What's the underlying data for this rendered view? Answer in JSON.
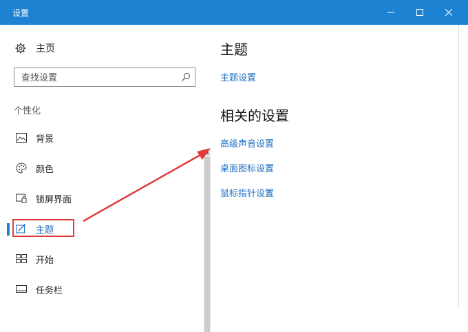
{
  "window": {
    "title": "设置",
    "accent": "#1e82d2",
    "controls": {
      "minimize": "—",
      "maximize": "☐",
      "close": "✕"
    }
  },
  "sidebar": {
    "home_label": "主页",
    "search_placeholder": "查找设置",
    "section_label": "个性化",
    "items": [
      {
        "label": "背景",
        "icon": "image-icon"
      },
      {
        "label": "颜色",
        "icon": "palette-icon"
      },
      {
        "label": "锁屏界面",
        "icon": "lock-screen-icon"
      },
      {
        "label": "主题",
        "icon": "theme-icon",
        "selected": true
      },
      {
        "label": "开始",
        "icon": "start-icon"
      },
      {
        "label": "任务栏",
        "icon": "taskbar-icon"
      }
    ]
  },
  "main": {
    "title": "主题",
    "theme_settings_link": "主题设置",
    "related_title": "相关的设置",
    "related_links": [
      "高级声音设置",
      "桌面图标设置",
      "鼠标指针设置"
    ]
  },
  "annotation": {
    "color": "#e23a3a"
  }
}
